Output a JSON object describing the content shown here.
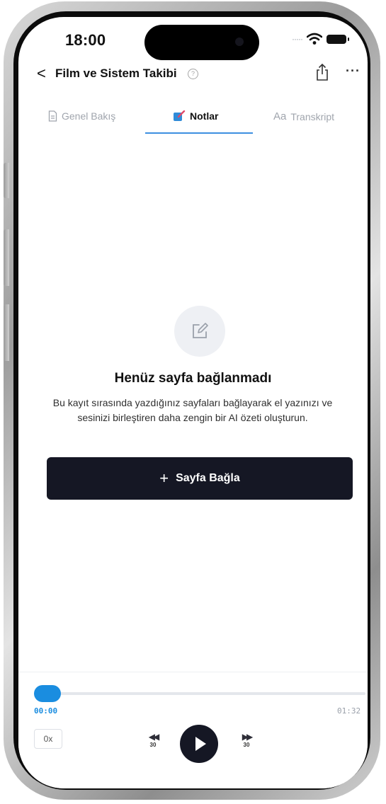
{
  "status": {
    "time": "18:00"
  },
  "nav": {
    "back_glyph": "<",
    "title": "Film ve Sistem Takibi",
    "info_glyph": "?",
    "more_glyph": "···"
  },
  "tabs": [
    {
      "label": "Genel Bakış",
      "icon": "document-icon",
      "active": false
    },
    {
      "label": "Notlar",
      "icon": "pencil-note-icon",
      "active": true
    },
    {
      "label": "Transkript",
      "icon_text": "Aa",
      "active": false
    }
  ],
  "empty_state": {
    "icon": "edit-icon",
    "title": "Henüz sayfa bağlanmadı",
    "description": "Bu kayıt sırasında yazdığınız sayfaları bağlayarak el yazınızı ve sesinizi birleştiren daha zengin bir AI özeti oluşturun.",
    "button_plus": "+",
    "button_label": "Sayfa Bağla"
  },
  "player": {
    "current_time": "00:00",
    "total_time": "01:32",
    "progress": 0.0,
    "speed": "0x",
    "rewind_seconds": "30",
    "forward_seconds": "30"
  },
  "colors": {
    "accent": "#1a8de0",
    "dark_button": "#151724",
    "tab_underline": "#3d8fe0"
  }
}
